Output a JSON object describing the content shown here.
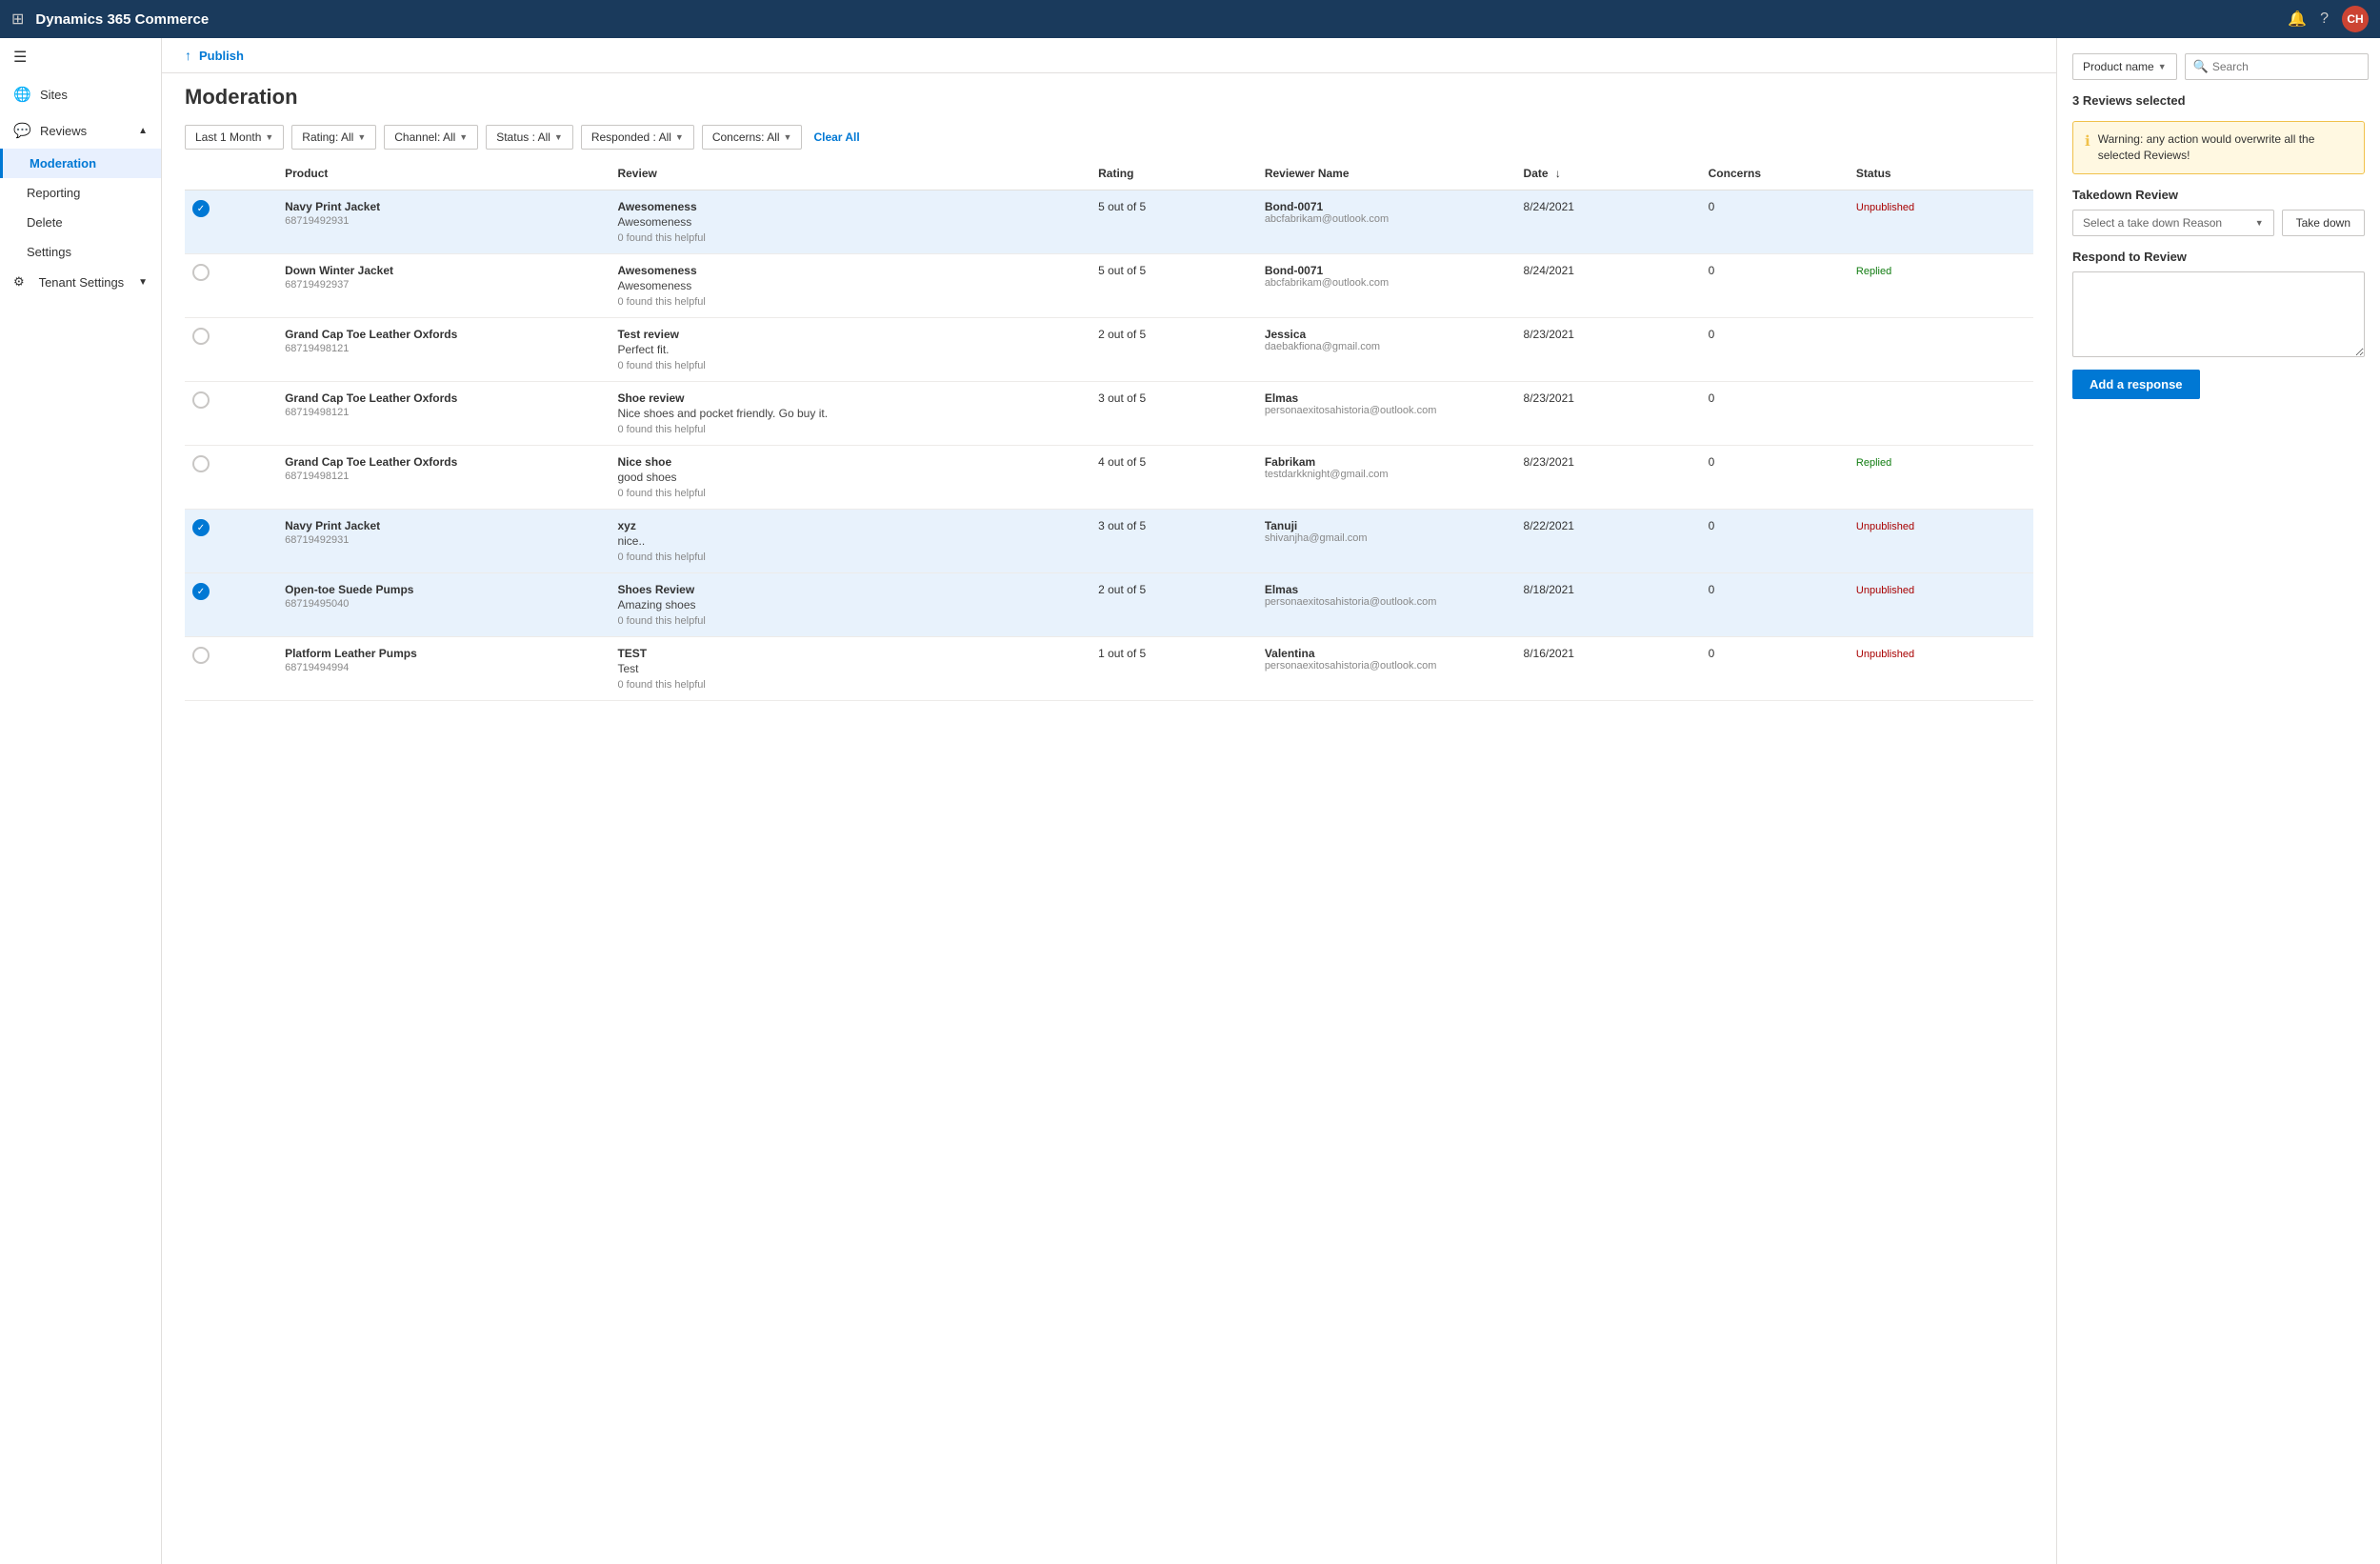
{
  "app": {
    "title": "Dynamics 365 Commerce",
    "avatar": "CH"
  },
  "sidebar": {
    "hamburger": "☰",
    "items": [
      {
        "id": "sites",
        "label": "Sites",
        "icon": "🌐"
      },
      {
        "id": "reviews",
        "label": "Reviews",
        "icon": "💬",
        "expanded": true
      },
      {
        "id": "moderation",
        "label": "Moderation",
        "active": true
      },
      {
        "id": "reporting",
        "label": "Reporting"
      },
      {
        "id": "delete",
        "label": "Delete"
      },
      {
        "id": "settings",
        "label": "Settings"
      },
      {
        "id": "tenant-settings",
        "label": "Tenant Settings",
        "icon": "⚙"
      }
    ]
  },
  "publish": {
    "label": "Publish"
  },
  "page": {
    "title": "Moderation"
  },
  "filters": {
    "date": "Last 1 Month",
    "rating": "Rating: All",
    "channel": "Channel: All",
    "status": "Status : All",
    "responded": "Responded : All",
    "concerns": "Concerns: All",
    "clearAll": "Clear All"
  },
  "table": {
    "headers": {
      "product": "Product",
      "review": "Review",
      "rating": "Rating",
      "reviewer": "Reviewer Name",
      "date": "Date",
      "concerns": "Concerns",
      "status": "Status"
    },
    "rows": [
      {
        "id": 1,
        "selected": true,
        "productName": "Navy Print Jacket",
        "productId": "68719492931",
        "reviewTitle": "Awesomeness",
        "reviewBody": "Awesomeness",
        "helpful": "0 found this helpful",
        "rating": "5 out of 5",
        "reviewerName": "Bond-0071",
        "reviewerEmail": "abcfabrikam@outlook.com",
        "date": "8/24/2021",
        "concerns": "0",
        "status": "Unpublished",
        "statusClass": "status-unpublished"
      },
      {
        "id": 2,
        "selected": false,
        "productName": "Down Winter Jacket",
        "productId": "68719492937",
        "reviewTitle": "Awesomeness",
        "reviewBody": "Awesomeness",
        "helpful": "0 found this helpful",
        "rating": "5 out of 5",
        "reviewerName": "Bond-0071",
        "reviewerEmail": "abcfabrikam@outlook.com",
        "date": "8/24/2021",
        "concerns": "0",
        "status": "Replied",
        "statusClass": "status-replied"
      },
      {
        "id": 3,
        "selected": false,
        "productName": "Grand Cap Toe Leather Oxfords",
        "productId": "68719498121",
        "reviewTitle": "Test review",
        "reviewBody": "Perfect fit.",
        "helpful": "0 found this helpful",
        "rating": "2 out of 5",
        "reviewerName": "Jessica",
        "reviewerEmail": "daebakfiona@gmail.com",
        "date": "8/23/2021",
        "concerns": "0",
        "status": "",
        "statusClass": ""
      },
      {
        "id": 4,
        "selected": false,
        "productName": "Grand Cap Toe Leather Oxfords",
        "productId": "68719498121",
        "reviewTitle": "Shoe review",
        "reviewBody": "Nice shoes and pocket friendly. Go buy it.",
        "helpful": "0 found this helpful",
        "rating": "3 out of 5",
        "reviewerName": "Elmas",
        "reviewerEmail": "personaexitosahistoria@outlook.com",
        "date": "8/23/2021",
        "concerns": "0",
        "status": "",
        "statusClass": ""
      },
      {
        "id": 5,
        "selected": false,
        "productName": "Grand Cap Toe Leather Oxfords",
        "productId": "68719498121",
        "reviewTitle": "Nice shoe",
        "reviewBody": "good shoes",
        "helpful": "0 found this helpful",
        "rating": "4 out of 5",
        "reviewerName": "Fabrikam",
        "reviewerEmail": "testdarkknight@gmail.com",
        "date": "8/23/2021",
        "concerns": "0",
        "status": "Replied",
        "statusClass": "status-replied"
      },
      {
        "id": 6,
        "selected": true,
        "productName": "Navy Print Jacket",
        "productId": "68719492931",
        "reviewTitle": "xyz",
        "reviewBody": "nice..",
        "helpful": "0 found this helpful",
        "rating": "3 out of 5",
        "reviewerName": "Tanuji",
        "reviewerEmail": "shivanjha@gmail.com",
        "date": "8/22/2021",
        "concerns": "0",
        "status": "Unpublished",
        "statusClass": "status-unpublished"
      },
      {
        "id": 7,
        "selected": true,
        "productName": "Open-toe Suede Pumps",
        "productId": "68719495040",
        "reviewTitle": "Shoes Review",
        "reviewBody": "Amazing shoes",
        "helpful": "0 found this helpful",
        "rating": "2 out of 5",
        "reviewerName": "Elmas",
        "reviewerEmail": "personaexitosahistoria@outlook.com",
        "date": "8/18/2021",
        "concerns": "0",
        "status": "Unpublished",
        "statusClass": "status-unpublished"
      },
      {
        "id": 8,
        "selected": false,
        "productName": "Platform Leather Pumps",
        "productId": "68719494994",
        "reviewTitle": "TEST",
        "reviewBody": "Test",
        "helpful": "0 found this helpful",
        "rating": "1 out of 5",
        "reviewerName": "Valentina",
        "reviewerEmail": "personaexitosahistoria@outlook.com",
        "date": "8/16/2021",
        "concerns": "0",
        "status": "Unpublished",
        "statusClass": "status-unpublished"
      }
    ]
  },
  "rightPanel": {
    "productNameLabel": "Product name",
    "searchPlaceholder": "Search",
    "selectedCount": "3 Reviews selected",
    "warning": "Warning: any action would overwrite all the selected Reviews!",
    "takedownTitle": "Takedown Review",
    "takedownPlaceholder": "Select a take down Reason",
    "takedownBtn": "Take down",
    "respondTitle": "Respond to Review",
    "addResponseBtn": "Add a response"
  }
}
